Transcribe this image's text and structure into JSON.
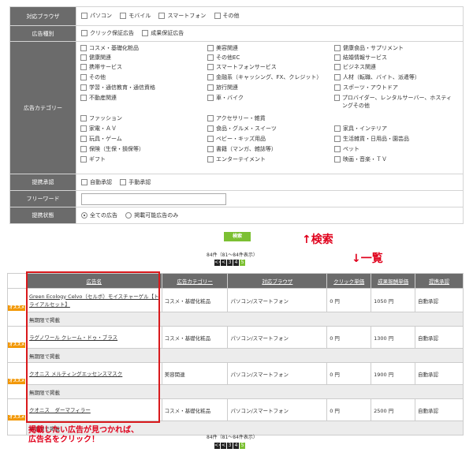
{
  "browser": {
    "label": "対応ブラウザ",
    "options": [
      "パソコン",
      "モバイル",
      "スマートフォン",
      "その他"
    ]
  },
  "ad_type": {
    "label": "広告種別",
    "options": [
      "クリック保証広告",
      "成果保証広告"
    ]
  },
  "category": {
    "label": "広告カテゴリー",
    "col1": [
      "コスメ・基礎化粧品",
      "健康関連",
      "携帯サービス",
      "その他",
      "学習・通信教育・通信資格",
      "不動産関連",
      "ファッション",
      "家電・ＡＶ",
      "玩具・ゲーム",
      "保険（生保・損保等）",
      "ギフト"
    ],
    "col2": [
      "美容関連",
      "その他EC",
      "スマートフォンサービス",
      "金融系（キャッシング、FX、クレジット）",
      "旅行関連",
      "車・バイク",
      "アクセサリー・雑貨",
      "食品・グルメ・スイーツ",
      "ベビー・キッズ用品",
      "書籍（マンガ、雑誌等）",
      "エンターテイメント"
    ],
    "col3": [
      "健康食品・サプリメント",
      "結婚情報サービス",
      "ビジネス関連",
      "人材（転職、バイト、派遣等）",
      "スポーツ・アウトドア",
      "プロバイダー、レンタルサーバー、ホスティングその他",
      "家具・インテリア",
      "生活雑貨・日用品・園芸品",
      "ペット",
      "映画・音楽・ＴＶ"
    ]
  },
  "approval": {
    "label": "提携承認",
    "options": [
      "自動承認",
      "手動承認"
    ]
  },
  "freeword": {
    "label": "フリーワード",
    "value": ""
  },
  "status": {
    "label": "提携状態",
    "options": [
      "全ての広告",
      "掲載可能広告のみ"
    ]
  },
  "search_button": "検索",
  "count_text": "84件（81〜84件表示）",
  "pager": [
    "<<",
    "<",
    "3",
    "4",
    "5"
  ],
  "annotations": {
    "search": "↑検索",
    "list": "↓一覧",
    "click_hint_1": "掲載したい広告が見つかれば、",
    "click_hint_2": "広告名をクリック！"
  },
  "table": {
    "headers": [
      "広告名",
      "広告カテゴリー",
      "対応ブラウザ",
      "クリック単価",
      "成果報酬単価",
      "提携承認"
    ],
    "badge": "オススメ",
    "rows": [
      {
        "name": "Green Ecology Celvo（セルボ）モイスチャーゲル【トライアルセット】",
        "category": "コスメ・基礎化粧品",
        "browser": "パソコン/スマートフォン",
        "click": "0 円",
        "reward": "1050 円",
        "approval": "自動承認",
        "period": "無期限で掲載"
      },
      {
        "name": "ラグノワール クレーム・ドゥ・ブラス",
        "category": "コスメ・基礎化粧品",
        "browser": "パソコン/スマートフォン",
        "click": "0 円",
        "reward": "1300 円",
        "approval": "自動承認",
        "period": "無期限で掲載"
      },
      {
        "name": "クオニス メルティングエッセンスマスク",
        "category": "美容関連",
        "browser": "パソコン/スマートフォン",
        "click": "0 円",
        "reward": "1900 円",
        "approval": "自動承認",
        "period": "無期限で掲載"
      },
      {
        "name": "クオニス　ダーマフィラー",
        "category": "コスメ・基礎化粧品",
        "browser": "パソコン/スマートフォン",
        "click": "0 円",
        "reward": "2500 円",
        "approval": "自動承認",
        "period": "無期限で掲載"
      }
    ]
  }
}
